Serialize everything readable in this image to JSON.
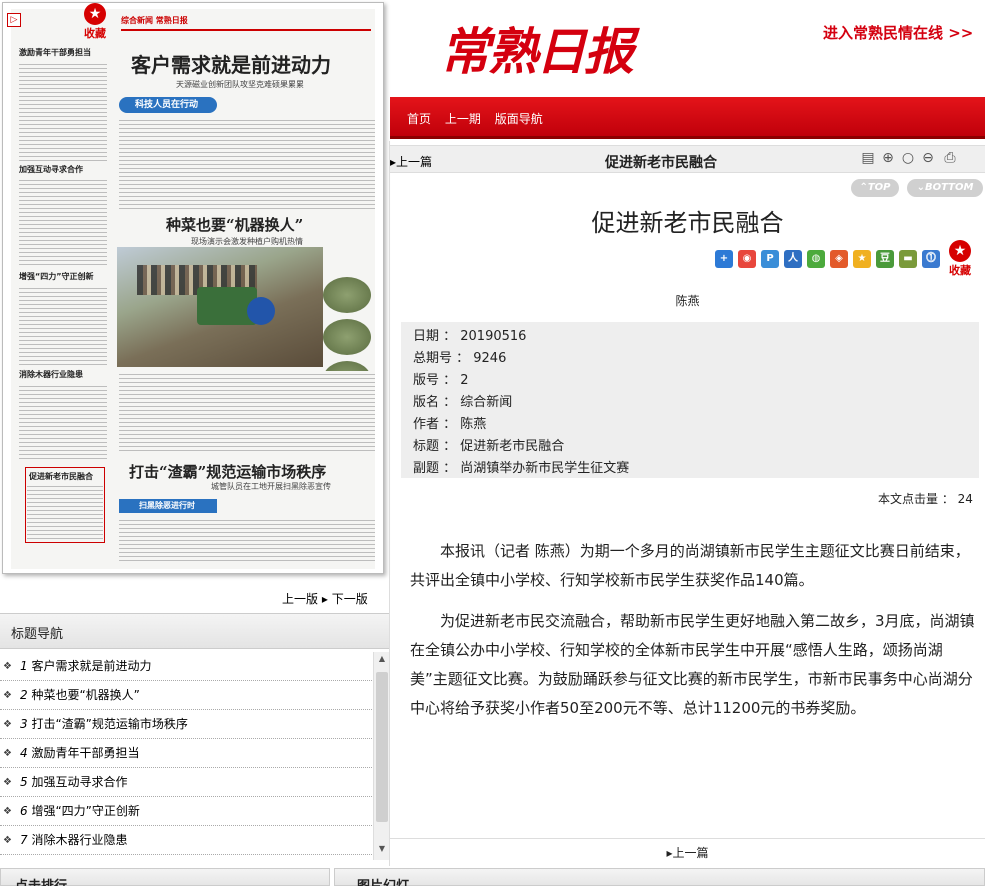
{
  "paper": {
    "favorite_label": "收藏",
    "masthead": "综合新闻 常熟日报",
    "headline1": "客户需求就是前进动力",
    "sub1": "天源磁业创新团队攻坚克难硕果累累",
    "banner1": "科技人员在行动",
    "left_heads": [
      "激励青年干部勇担当",
      "加强互动寻求合作",
      "增强“四力”守正创新",
      "消除木器行业隐患"
    ],
    "headline2": "种菜也要“机器换人”",
    "sub2": "现场演示会激发种植户购机热情",
    "headline3": "打击“渣霸”规范运输市场秩序",
    "sub3": "城管队员在工地开展扫黑除恶宣传",
    "banner2": "扫黑除恶进行时",
    "highlight_title": "促进新老市民融合"
  },
  "pager_left": {
    "prev": "上一版",
    "next": "下一版"
  },
  "title_nav": {
    "heading": "标题导航",
    "items": [
      {
        "num": "1",
        "title": "客户需求就是前进动力"
      },
      {
        "num": "2",
        "title": "种菜也要“机器换人”"
      },
      {
        "num": "3",
        "title": "打击“渣霸”规范运输市场秩序"
      },
      {
        "num": "4",
        "title": "激励青年干部勇担当"
      },
      {
        "num": "5",
        "title": "加强互动寻求合作"
      },
      {
        "num": "6",
        "title": "增强“四力”守正创新"
      },
      {
        "num": "7",
        "title": "消除木器行业隐患"
      }
    ]
  },
  "bottom_tabs": {
    "left": "点击排行",
    "right": "图片幻灯"
  },
  "header": {
    "logo": "常熟日报",
    "enter_link": "进入常熟民情在线 >>",
    "nav": [
      "首页",
      "上一期",
      "版面导航"
    ]
  },
  "toolbar": {
    "prev": "上一篇",
    "title": "促进新老市民融合"
  },
  "pills": {
    "top": "TOP",
    "bottom": "BOTTOM"
  },
  "article": {
    "title": "促进新老市民融合",
    "author": "陈燕",
    "favorite_label": "收藏",
    "meta": {
      "date": "日期 ： 20190516",
      "issue": "总期号 ： 9246",
      "page": "版号 ： 2",
      "section": "版名 ： 综合新闻",
      "author": "作者 ： 陈燕",
      "title": "标题 ： 促进新老市民融合",
      "subtitle": "副题 ： 尚湖镇举办新市民学生征文赛"
    },
    "hits": "本文点击量 ： 24",
    "paragraphs": [
      "本报讯（记者 陈燕）为期一个多月的尚湖镇新市民学生主题征文比赛日前结束，共评出全镇中小学校、行知学校新市民学生获奖作品140篇。",
      "为促进新老市民交流融合，帮助新市民学生更好地融入第二故乡，3月底，尚湖镇在全镇公办中小学校、行知学校的全体新市民学生中开展“感悟人生路，颂扬尚湖美”主题征文比赛。为鼓励踊跃参与征文比赛的新市民学生，市新市民事务中心尚湖分中心将给予获奖小作者50至200元不等、总计11200元的书券奖励。"
    ]
  },
  "pager_right": {
    "prev": "上一篇"
  },
  "colors": {
    "brand_red": "#d4000f",
    "banner_blue": "#2a72c0"
  }
}
